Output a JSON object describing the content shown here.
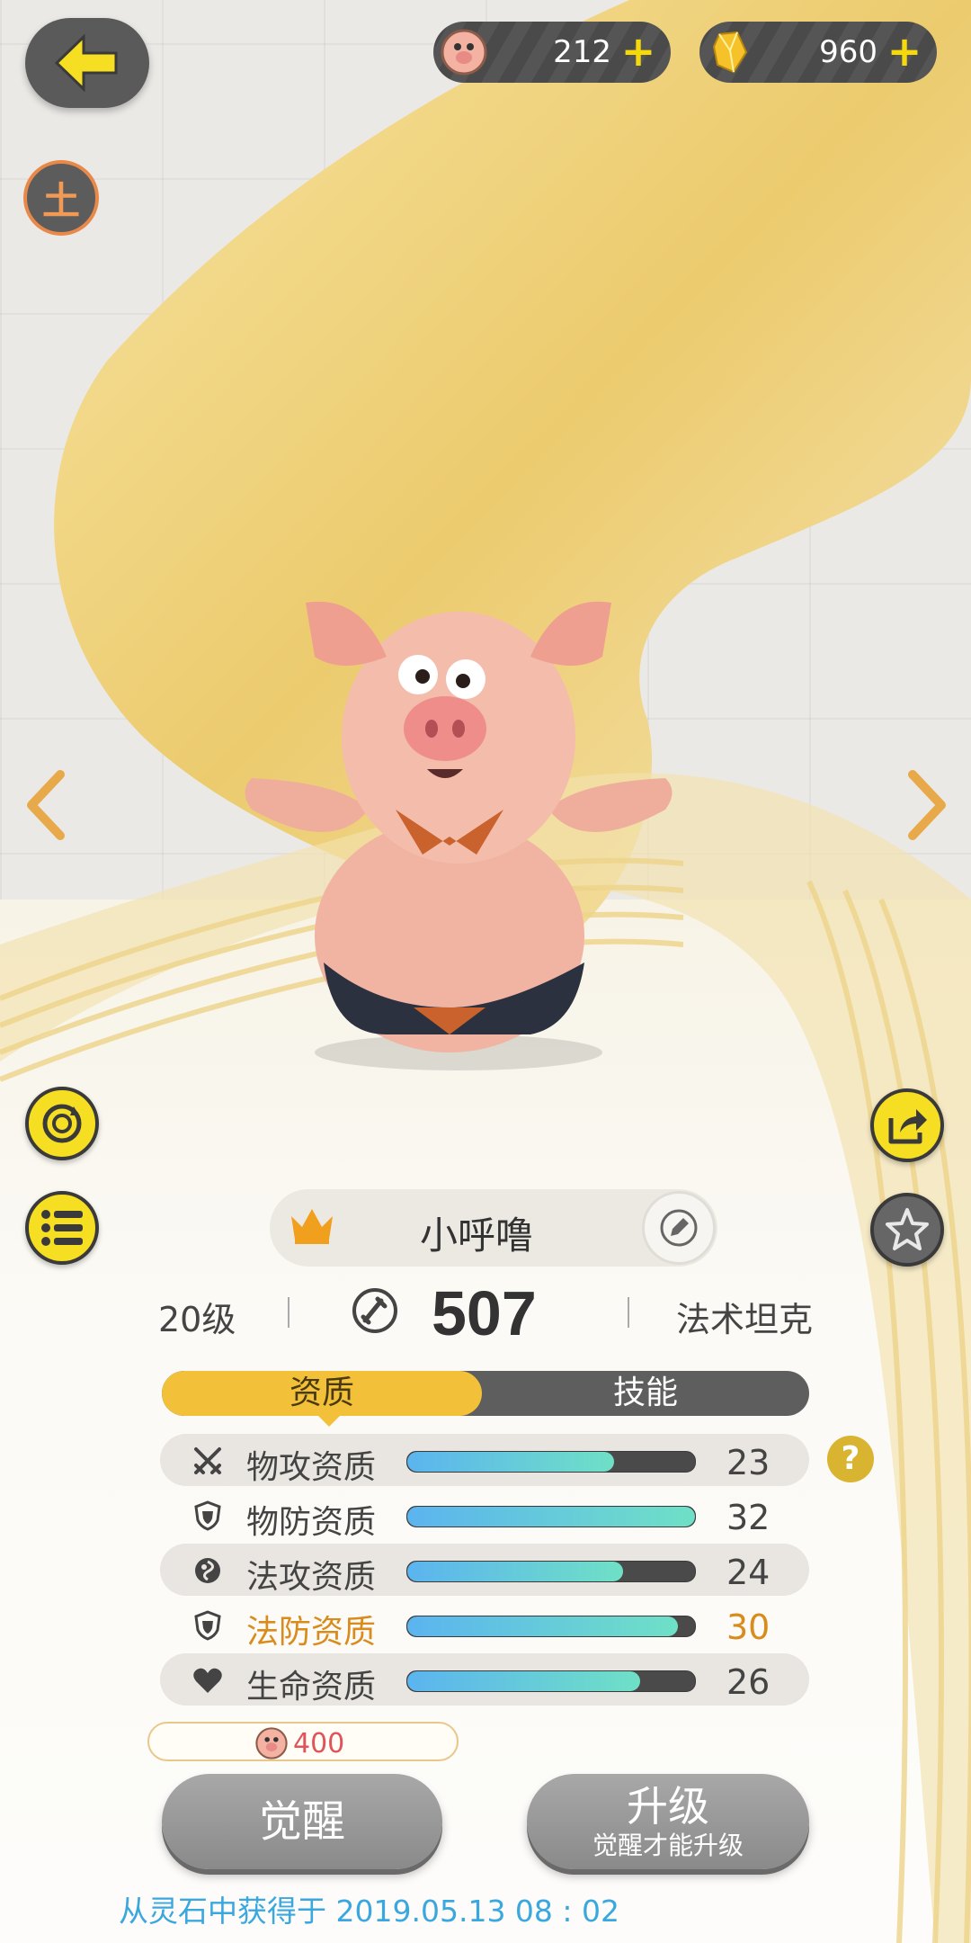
{
  "resources": [
    {
      "icon": "pig-coin-icon",
      "value": "212",
      "plus": "+"
    },
    {
      "icon": "gold-crystal-icon",
      "value": "960",
      "plus": "+"
    }
  ],
  "element_badge": "土",
  "pet": {
    "name": "小呼噜",
    "level": "20级",
    "power": "507",
    "role": "法术坦克"
  },
  "tabs": {
    "aptitude": "资质",
    "skills": "技能"
  },
  "attributes": [
    {
      "icon": "crossed-swords-icon",
      "label": "物攻资质",
      "value": "23",
      "fill": 0.72,
      "highlight": false
    },
    {
      "icon": "shield-icon",
      "label": "物防资质",
      "value": "32",
      "fill": 1.0,
      "highlight": false
    },
    {
      "icon": "magic-orb-icon",
      "label": "法攻资质",
      "value": "24",
      "fill": 0.75,
      "highlight": false
    },
    {
      "icon": "magic-shield-icon",
      "label": "法防资质",
      "value": "30",
      "fill": 0.94,
      "highlight": true
    },
    {
      "icon": "heart-icon",
      "label": "生命资质",
      "value": "26",
      "fill": 0.81,
      "highlight": false
    }
  ],
  "help_label": "?",
  "cost": {
    "icon": "pig-coin-icon",
    "value": "400"
  },
  "buttons": {
    "awaken": "觉醒",
    "upgrade": "升级",
    "upgrade_note": "觉醒才能升级"
  },
  "obtained": "从灵石中获得于 2019.05.13   08 : 02",
  "colors": {
    "accent_yellow": "#f3c139",
    "bar_start": "#5bb4ef",
    "bar_end": "#6fe0c6",
    "highlight": "#d98b1b",
    "obtain_text": "#3aa7df"
  }
}
